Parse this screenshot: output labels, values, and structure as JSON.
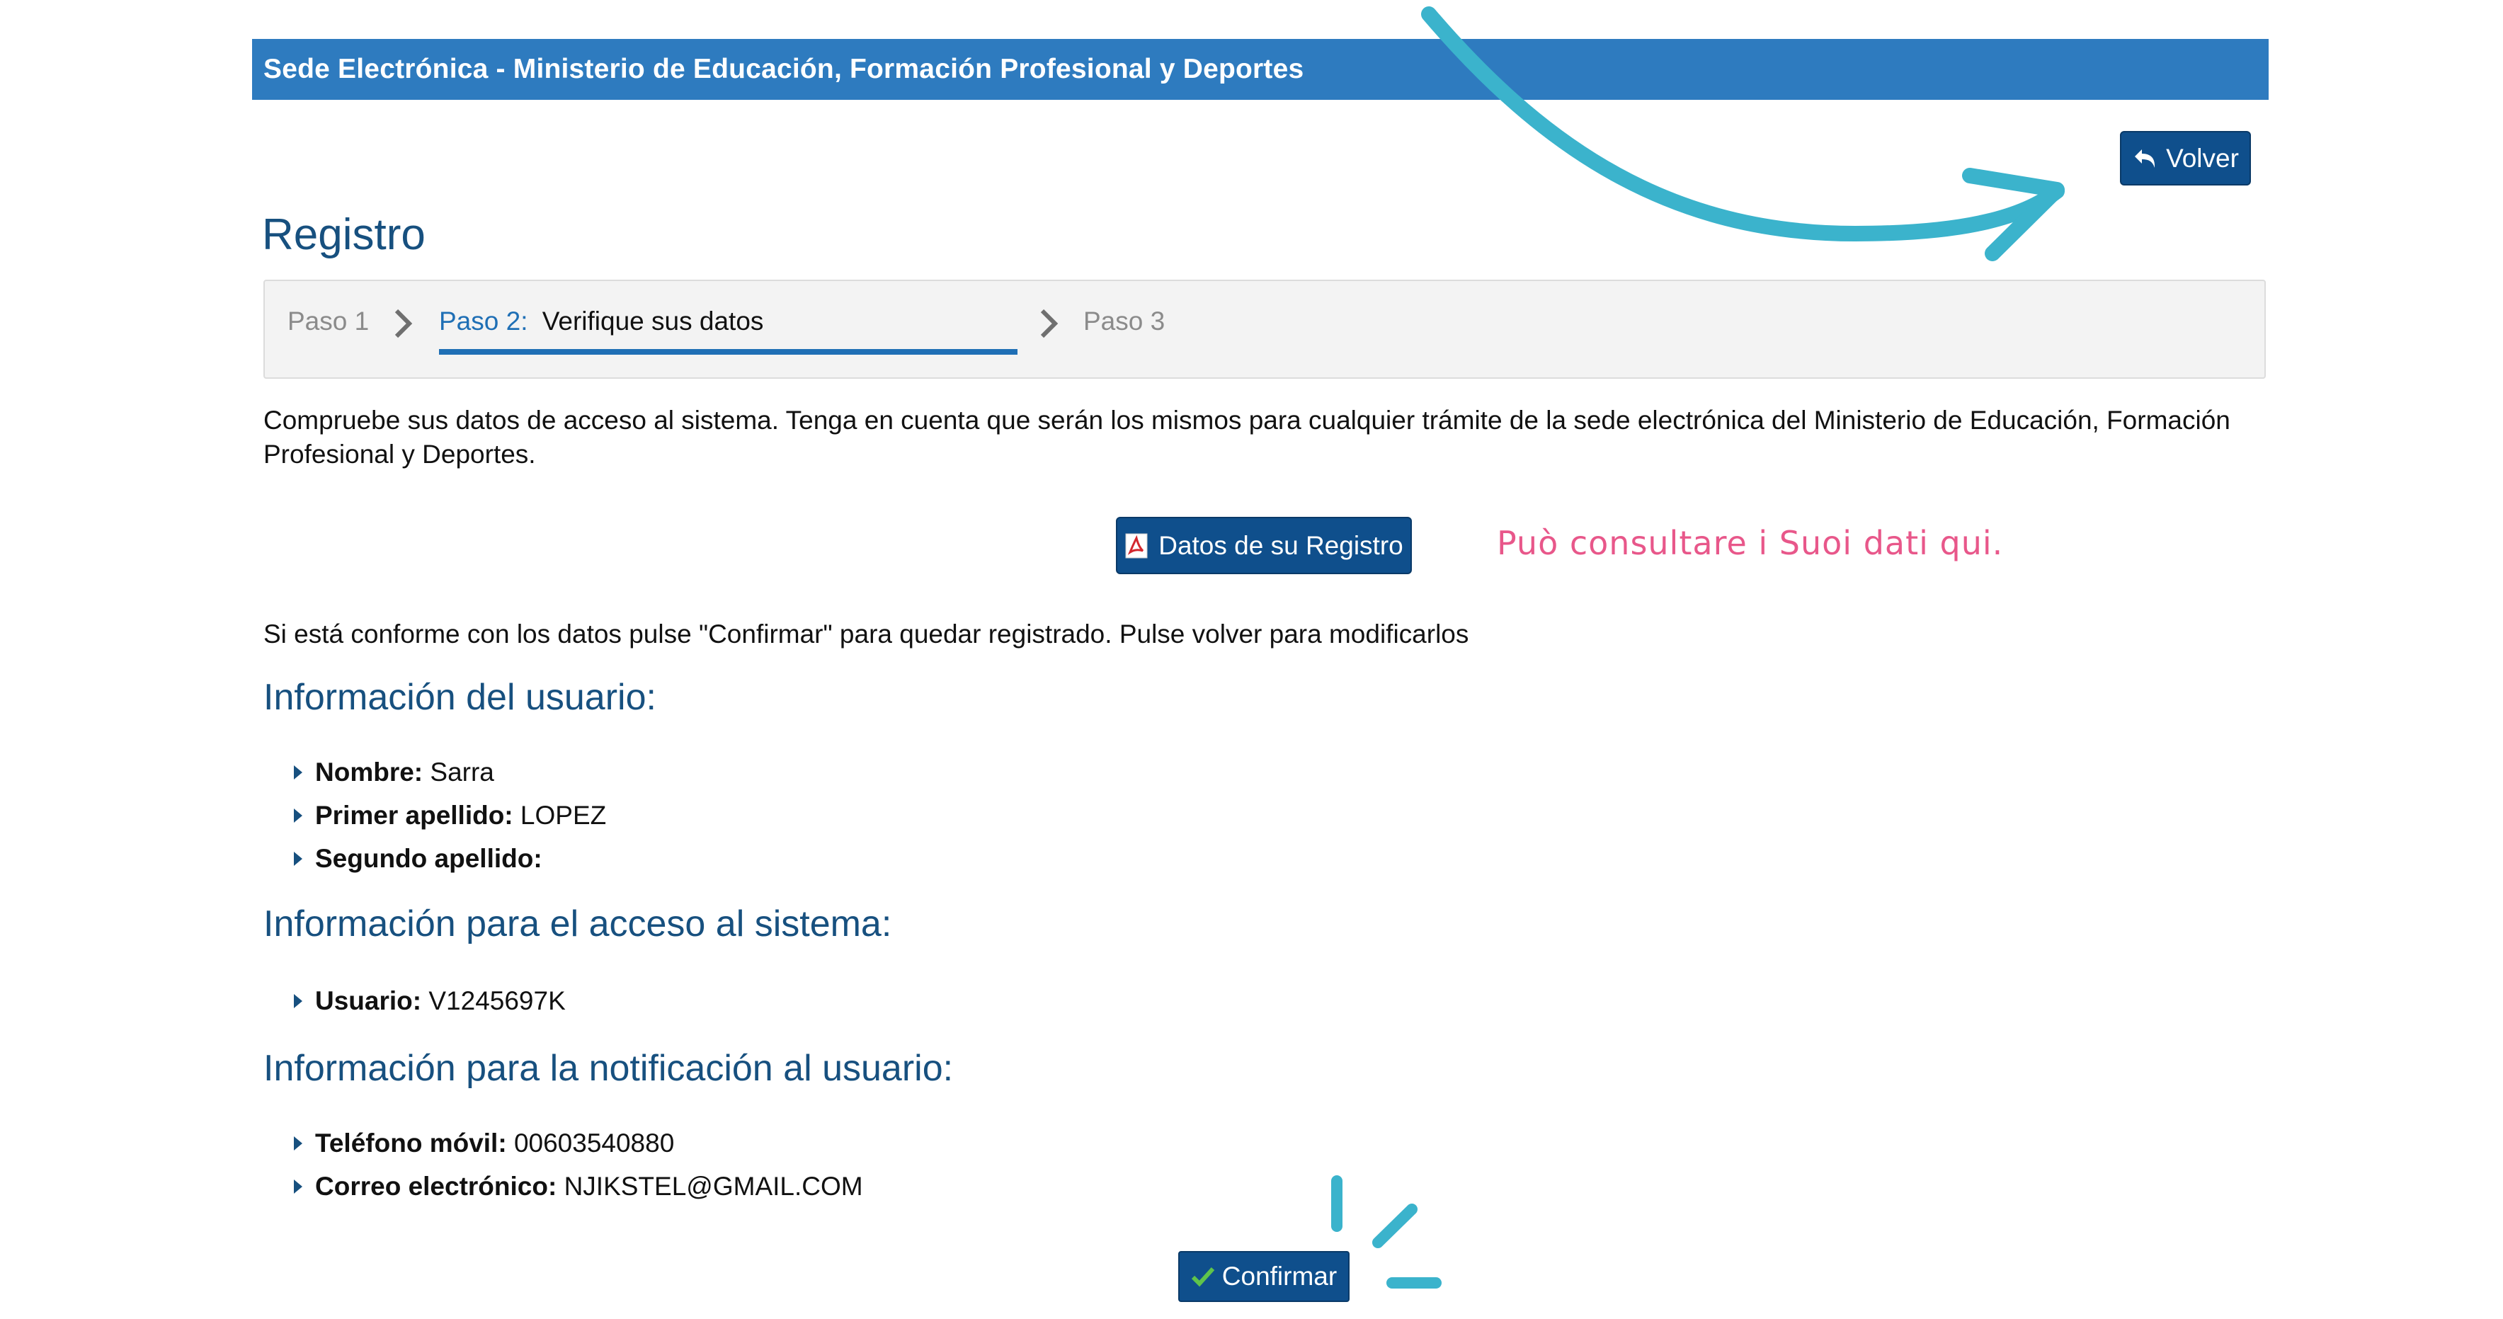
{
  "header": {
    "title": "Sede Electrónica - Ministerio de Educación, Formación Profesional y Deportes"
  },
  "actions": {
    "volver_label": "Volver",
    "datos_label": "Datos de su Registro",
    "confirmar_label": "Confirmar"
  },
  "page": {
    "title": "Registro"
  },
  "steps": {
    "step1": "Paso 1",
    "step2_label": "Paso 2:",
    "step2_text": "Verifique sus datos",
    "step3": "Paso 3"
  },
  "text": {
    "intro_line1": "Compruebe sus datos de acceso al sistema. Tenga en cuenta que serán los mismos para cualquier trámite de la sede electrónica del Ministerio de Educación, Formación",
    "intro_line2": "Profesional y Deportes.",
    "confirm_instructions": "Si está conforme con los datos pulse \"Confirmar\" para quedar registrado. Pulse volver para modificarlos"
  },
  "annotation": {
    "text": "Può consultare i Suoi dati qui."
  },
  "sections": {
    "usuario": {
      "title": "Información del usuario:",
      "items": [
        {
          "label": "Nombre:",
          "value": "Sarra"
        },
        {
          "label": "Primer apellido:",
          "value": "LOPEZ"
        },
        {
          "label": "Segundo apellido:",
          "value": ""
        }
      ]
    },
    "acceso": {
      "title": "Información para el acceso al sistema:",
      "items": [
        {
          "label": "Usuario:",
          "value": "V1245697K"
        }
      ]
    },
    "notificacion": {
      "title": "Información para la notificación al usuario:",
      "items": [
        {
          "label": "Teléfono móvil:",
          "value": "00603540880"
        },
        {
          "label": "Correo electrónico:",
          "value": "NJIKSTEL@GMAIL.COM"
        }
      ]
    }
  },
  "icons": {
    "volver": "undo-arrow-icon",
    "datos": "pdf-icon",
    "confirmar": "checkmark-icon",
    "bullet": "triangle-bullet-icon"
  },
  "colors": {
    "header": "#2e7bbf",
    "button": "#0f4f8c",
    "heading": "#17507f",
    "annotation": "#e8578a",
    "overlay": "#3bb3cc"
  }
}
